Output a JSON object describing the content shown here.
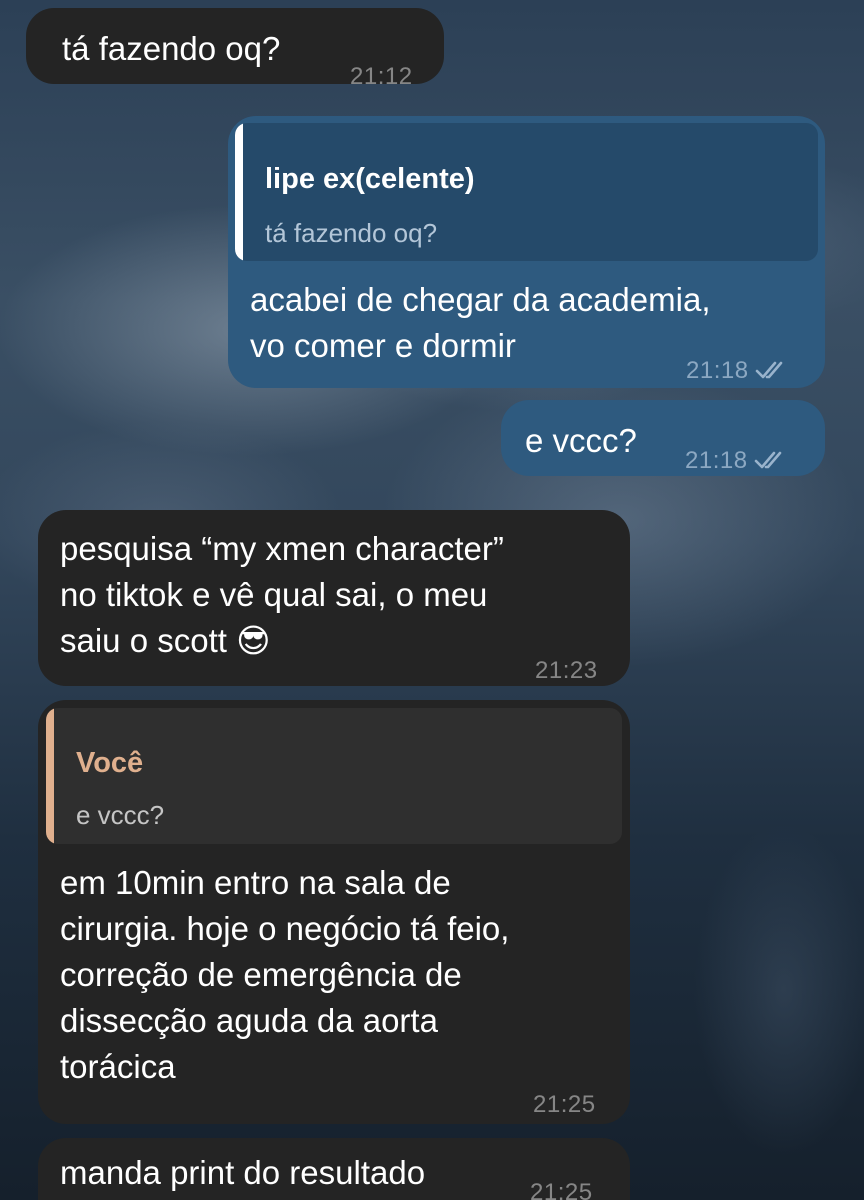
{
  "messages": [
    {
      "id": "m1",
      "direction": "incoming",
      "text": "tá fazendo oq?",
      "time": "21:12"
    },
    {
      "id": "m2",
      "direction": "outgoing",
      "reply_to": {
        "name": "lipe ex(celente)",
        "text": "tá fazendo oq?"
      },
      "text": "acabei de chegar da academia,\nvo comer e dormir",
      "time": "21:18",
      "status": "read"
    },
    {
      "id": "m3",
      "direction": "outgoing",
      "text": "e vccc?",
      "time": "21:18",
      "status": "read"
    },
    {
      "id": "m4",
      "direction": "incoming",
      "text": "pesquisa “my xmen character”\nno tiktok e vê qual sai, o meu\nsaiu o scott",
      "emoji": "😎",
      "time": "21:23"
    },
    {
      "id": "m5",
      "direction": "incoming",
      "reply_to": {
        "name": "Você",
        "text": "e vccc?"
      },
      "text": "em 10min entro na sala de\ncirurgia. hoje o negócio tá feio,\ncorreção de emergência de\ndissecção aguda da aorta\ntorácica",
      "time": "21:25"
    },
    {
      "id": "m6",
      "direction": "incoming",
      "text": "manda print do resultado",
      "time": "21:25"
    }
  ],
  "colors": {
    "incoming_bubble": "#242424",
    "outgoing_bubble": "#2e5a7f",
    "outgoing_quote_bg": "#254a6a",
    "outgoing_quote_name": "#ffffff",
    "incoming_quote_bg": "#2f2f2f",
    "incoming_quote_name": "#e0b08e",
    "incoming_quote_bar": "#e0b08e"
  },
  "icons": {
    "read_status": "double-check-icon"
  }
}
